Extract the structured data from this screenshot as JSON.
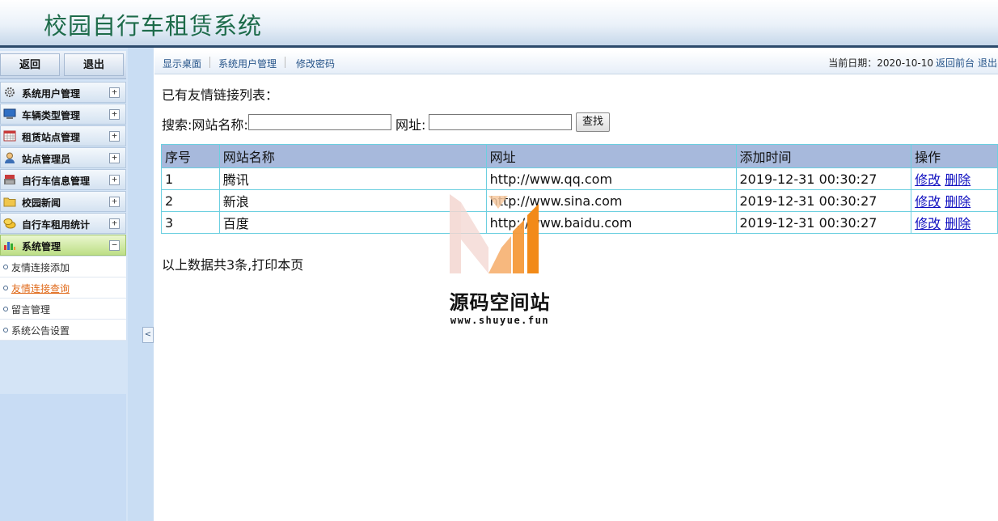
{
  "app": {
    "title": "校园自行车租赁系统"
  },
  "sidebar": {
    "back_label": "返回",
    "logout_label": "退出",
    "menus": [
      {
        "label": "系统用户管理",
        "icon": "gear-icon",
        "toggle": "+"
      },
      {
        "label": "车辆类型管理",
        "icon": "monitor-icon",
        "toggle": "+"
      },
      {
        "label": "租赁站点管理",
        "icon": "calendar-grid-icon",
        "toggle": "+"
      },
      {
        "label": "站点管理员",
        "icon": "person-icon",
        "toggle": "+"
      },
      {
        "label": "自行车信息管理",
        "icon": "cash-register-icon",
        "toggle": "+"
      },
      {
        "label": "校园新闻",
        "icon": "folder-icon",
        "toggle": "+"
      },
      {
        "label": "自行车租用统计",
        "icon": "coins-icon",
        "toggle": "+"
      },
      {
        "label": "系统管理",
        "icon": "bar-chart-icon",
        "toggle": "−"
      }
    ],
    "sub_items": [
      {
        "label": "友情连接添加"
      },
      {
        "label": "友情连接查询"
      },
      {
        "label": "留言管理"
      },
      {
        "label": "系统公告设置"
      }
    ],
    "collapse_glyph": "<"
  },
  "topnav": {
    "links": [
      "显示桌面",
      "系统用户管理",
      "修改密码"
    ],
    "date_text": "当前日期：2020-10-10",
    "back_front": "返回前台",
    "logout": "退出"
  },
  "main": {
    "heading": "已有友情链接列表：",
    "search_label": "搜索:网站名称:",
    "url_label": "网址:",
    "name_value": "",
    "url_value": "",
    "find_button": "查找",
    "table": {
      "headers": [
        "序号",
        "网站名称",
        "网址",
        "添加时间",
        "操作"
      ],
      "rows": [
        {
          "id": "1",
          "name": "腾讯",
          "url": "http://www.qq.com",
          "time": "2019-12-31 00:30:27"
        },
        {
          "id": "2",
          "name": "新浪",
          "url": "http://www.sina.com",
          "time": "2019-12-31 00:30:27"
        },
        {
          "id": "3",
          "name": "百度",
          "url": "http://www.baidu.com",
          "time": "2019-12-31 00:30:27"
        }
      ],
      "edit_label": "修改",
      "delete_label": "删除"
    },
    "summary": "以上数据共3条,打印本页"
  },
  "watermark": {
    "title": "源码空间站",
    "url": "www.shuyue.fun"
  },
  "colors": {
    "header_title": "#1d6b4a",
    "table_head": "#a7b9dc",
    "table_border": "#6ccfe0",
    "link": "#1010c0",
    "active_sub": "#e06a1a"
  }
}
